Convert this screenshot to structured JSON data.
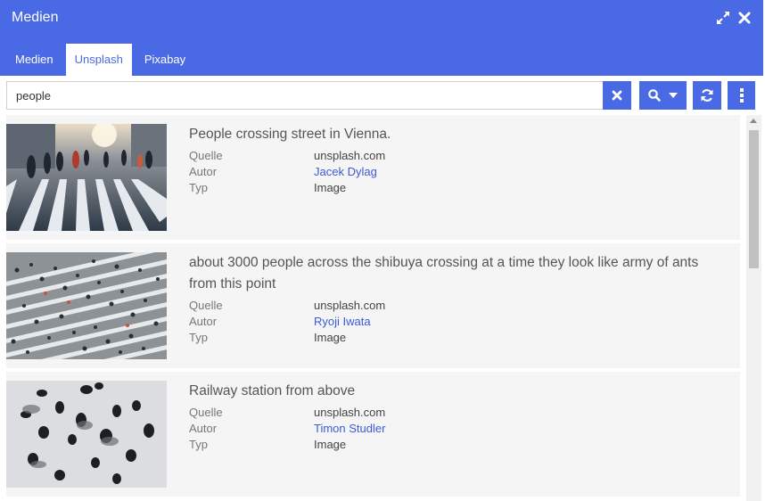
{
  "window": {
    "title": "Medien",
    "header_color": "#4a69e5",
    "controls": [
      "expand-icon",
      "close-icon"
    ]
  },
  "tabs": [
    {
      "label": "Medien",
      "active": false
    },
    {
      "label": "Unsplash",
      "active": true
    },
    {
      "label": "Pixabay",
      "active": false
    }
  ],
  "search": {
    "value": "people",
    "buttons": [
      "times-icon",
      "search-icon",
      "caret-down-icon",
      "refresh-icon",
      "ellipsis-vertical-icon"
    ]
  },
  "meta_labels": {
    "source": "Quelle",
    "author": "Autor",
    "type": "Typ"
  },
  "results": [
    {
      "title": "People crossing street in Vienna.",
      "source": "unsplash.com",
      "author": "Jacek Dylag",
      "type": "Image"
    },
    {
      "title": "about 3000 people across the shibuya crossing at a time they look like army of ants from this point",
      "source": "unsplash.com",
      "author": "Ryoji Iwata",
      "type": "Image"
    },
    {
      "title": "Railway station from above",
      "source": "unsplash.com",
      "author": "Timon Studler",
      "type": "Image"
    }
  ],
  "colors": {
    "accent": "#4a69e5",
    "link": "#3a5bd9",
    "item_background": "#f5f5f5"
  }
}
